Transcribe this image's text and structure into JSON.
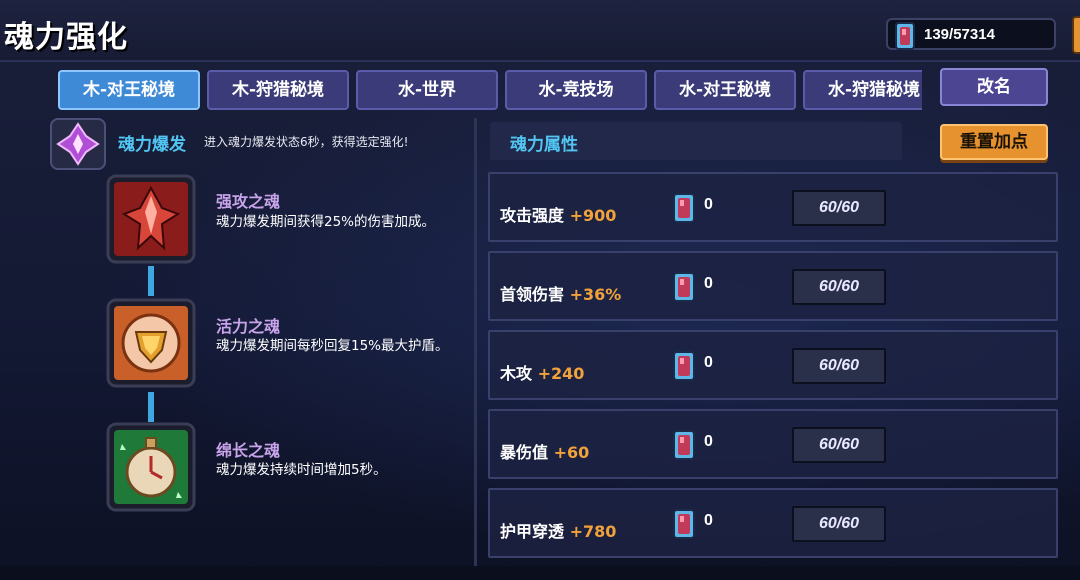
{
  "header": {
    "title": "魂力强化",
    "currency_value": "139/57314"
  },
  "tabs": [
    {
      "label": "木-对王秘境",
      "active": true
    },
    {
      "label": "木-狩猎秘境",
      "active": false
    },
    {
      "label": "水-世界",
      "active": false
    },
    {
      "label": "水-竞技场",
      "active": false
    },
    {
      "label": "水-对王秘境",
      "active": false
    },
    {
      "label": "水-狩猎秘境",
      "active": false
    }
  ],
  "rename_label": "改名",
  "burst": {
    "title": "魂力爆发",
    "desc": "进入魂力爆发状态6秒，获得选定强化!"
  },
  "skills": [
    {
      "name": "强攻之魂",
      "desc": "魂力爆发期间获得25%的伤害加成。",
      "icon": "attack-soul-icon"
    },
    {
      "name": "活力之魂",
      "desc": "魂力爆发期间每秒回复15%最大护盾。",
      "icon": "vitality-soul-icon"
    },
    {
      "name": "绵长之魂",
      "desc": "魂力爆发持续时间增加5秒。",
      "icon": "duration-soul-icon"
    }
  ],
  "attributes": {
    "header": "魂力属性",
    "reset_label": "重置加点",
    "rows": [
      {
        "label": "攻击强度",
        "bonus": "+900",
        "count": "0",
        "level": "60/60"
      },
      {
        "label": "首领伤害",
        "bonus": "+36%",
        "count": "0",
        "level": "60/60"
      },
      {
        "label": "木攻",
        "bonus": "+240",
        "count": "0",
        "level": "60/60"
      },
      {
        "label": "暴伤值",
        "bonus": "+60",
        "count": "0",
        "level": "60/60"
      },
      {
        "label": "护甲穿透",
        "bonus": "+780",
        "count": "0",
        "level": "60/60"
      }
    ]
  },
  "colors": {
    "accent_blue": "#52c6f2",
    "bonus_orange": "#f2a23a",
    "skill_name_purple": "#c7a3ea",
    "active_tab": "#3f8ad6",
    "reset_button": "#e6922f"
  }
}
